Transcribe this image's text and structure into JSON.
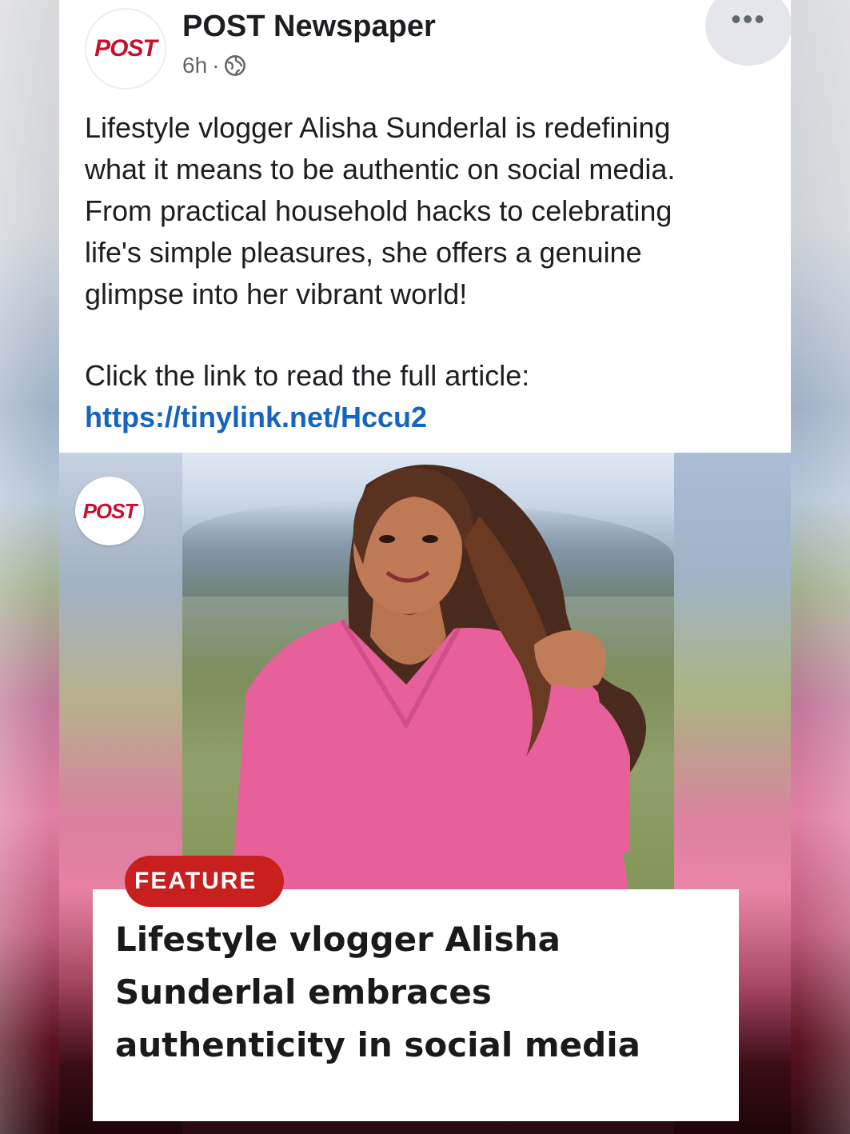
{
  "post": {
    "page_name": "POST Newspaper",
    "avatar_logo": "POST",
    "time": "6h",
    "separator": "·",
    "audience_icon": "globe-icon",
    "more_icon": "more-options-icon",
    "more_label": "•••",
    "body_lines": [
      "Lifestyle vlogger Alisha Sunderlal is redefining",
      "what it means to be authentic on social media.",
      "From practical household hacks to celebrating",
      "life's simple pleasures, she offers a genuine",
      "glimpse into her vibrant world!"
    ],
    "cta": "Click the link to read the full article:",
    "link": "https://tinylink.net/Hccu2"
  },
  "media": {
    "logo": "POST",
    "badge": "FEATURE",
    "headline": "Lifestyle vlogger Alisha Sunderlal embraces authenticity in social media"
  },
  "colors": {
    "brand_red": "#c8102e",
    "link_blue": "#1565c0",
    "badge_red": "#c81f1f",
    "dress_pink": "#e8609a"
  }
}
